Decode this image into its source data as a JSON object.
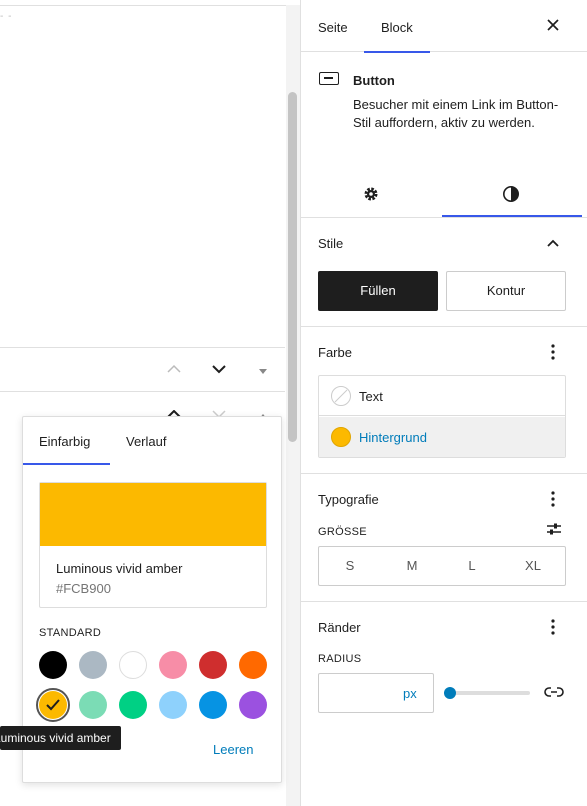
{
  "sidebar": {
    "tabs": [
      "Seite",
      "Block"
    ],
    "active_tab": "Block",
    "close_icon": "close-icon",
    "block": {
      "title": "Button",
      "description": "Besucher mit einem Link im Button-Stil auffordern, aktiv zu werden.",
      "icon": "button-icon"
    },
    "subtabs": [
      "settings-icon",
      "styles-icon"
    ],
    "stile": {
      "title": "Stile",
      "fill_label": "Füllen",
      "outline_label": "Kontur"
    },
    "farbe": {
      "title": "Farbe",
      "items": [
        {
          "label": "Text",
          "color": "#ffffff",
          "active": false
        },
        {
          "label": "Hintergrund",
          "color": "#fcb900",
          "active": true
        }
      ]
    },
    "typografie": {
      "title": "Typografie",
      "size_label": "GRÖSSE",
      "sizes": [
        "S",
        "M",
        "L",
        "XL"
      ]
    },
    "raender": {
      "title": "Ränder",
      "radius_label": "RADIUS",
      "radius_value": "",
      "unit": "px",
      "slider_value": 0
    }
  },
  "popover": {
    "tabs": [
      "Einfarbig",
      "Verlauf"
    ],
    "active_tab": "Einfarbig",
    "selected_name": "Luminous vivid amber",
    "selected_hex": "#FCB900",
    "selected_color": "#fcb900",
    "section_label": "STANDARD",
    "palette": [
      {
        "name": "Black",
        "color": "#000000"
      },
      {
        "name": "Cyan bluish gray",
        "color": "#abb8c3"
      },
      {
        "name": "White",
        "color": "#ffffff"
      },
      {
        "name": "Pale pink",
        "color": "#f78da7"
      },
      {
        "name": "Vivid red",
        "color": "#cf2e2e"
      },
      {
        "name": "Luminous vivid orange",
        "color": "#ff6900"
      },
      {
        "name": "Luminous vivid amber",
        "color": "#fcb900"
      },
      {
        "name": "Light green cyan",
        "color": "#7bdcb5"
      },
      {
        "name": "Vivid green cyan",
        "color": "#00d084"
      },
      {
        "name": "Pale cyan blue",
        "color": "#8ed1fc"
      },
      {
        "name": "Vivid cyan blue",
        "color": "#0693e3"
      },
      {
        "name": "Vivid purple",
        "color": "#9b51e0"
      }
    ],
    "clear_label": "Leeren",
    "tooltip": "Luminous vivid amber"
  },
  "colors": {
    "accent": "#3858e9",
    "link": "#007cba",
    "dark": "#1e1e1e"
  }
}
